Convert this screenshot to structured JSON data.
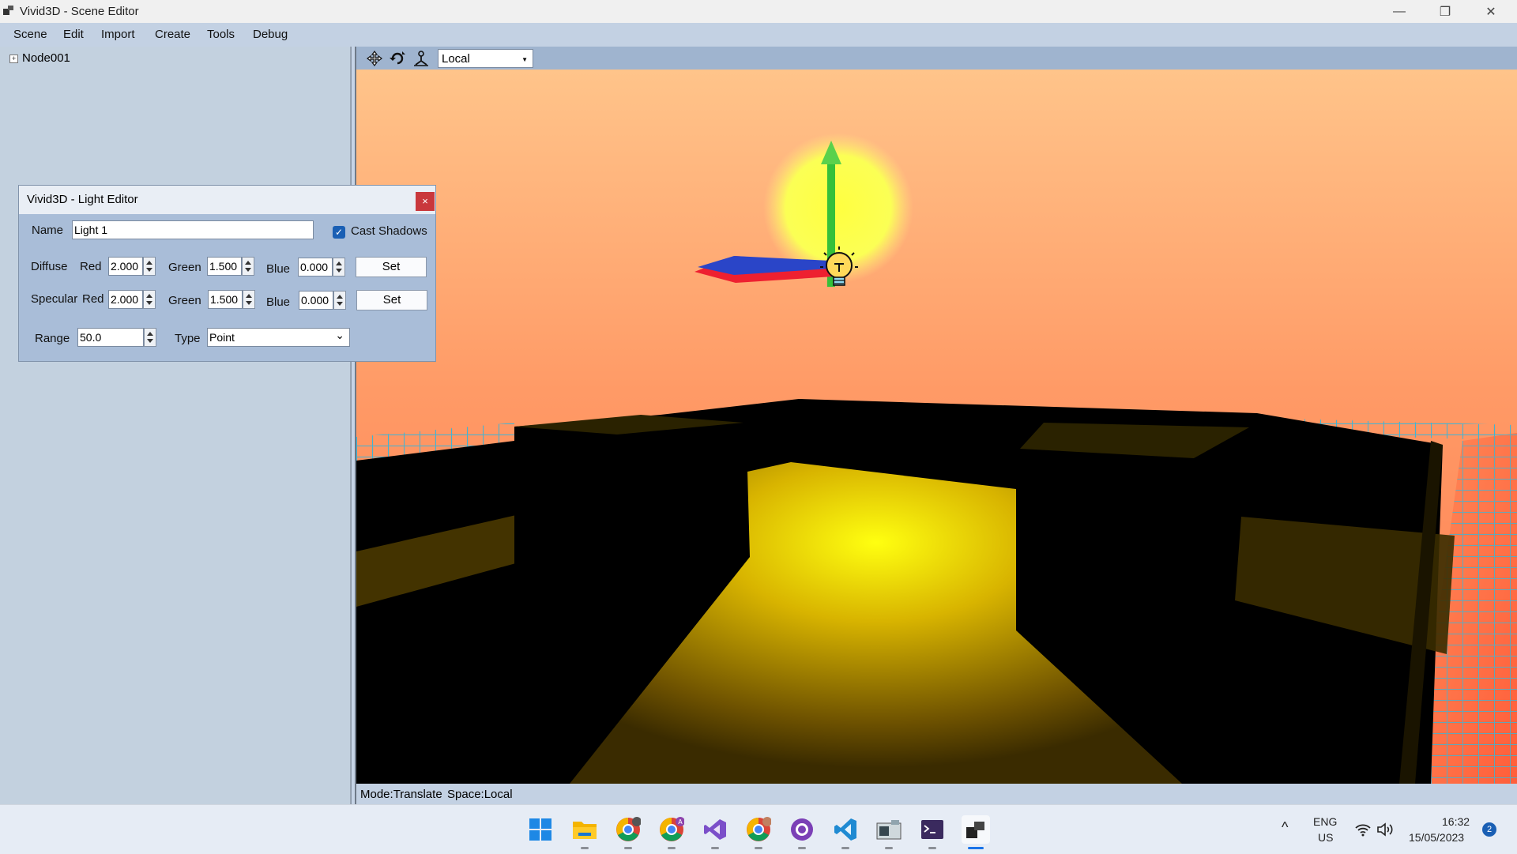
{
  "window": {
    "title": "Vivid3D - Scene Editor",
    "controls": {
      "minimize": "—",
      "restore": "❐",
      "close": "✕"
    }
  },
  "menu": [
    "Scene",
    "Edit",
    "Import",
    "Create",
    "Tools",
    "Debug"
  ],
  "scene_tree": {
    "expander": "+",
    "nodes": [
      {
        "label": "Node001"
      }
    ]
  },
  "viewport": {
    "toolbar": {
      "tools": [
        "move-icon",
        "rotate-icon",
        "scale-icon"
      ],
      "space_select": {
        "value": "Local",
        "arrow": "▼"
      }
    }
  },
  "status": {
    "mode": "Mode:Translate",
    "space": "Space:Local"
  },
  "light_editor": {
    "title": "Vivid3D - Light Editor",
    "close": "×",
    "name_label": "Name",
    "name_value": "Light 1",
    "cast_shadows_label": "Cast Shadows",
    "cast_shadows_checked": true,
    "check_mark": "✓",
    "diffuse": {
      "label": "Diffuse",
      "red_label": "Red",
      "red": "2.000",
      "green_label": "Green",
      "green": "1.500",
      "blue_label": "Blue",
      "blue": "0.000",
      "set_label": "Set"
    },
    "specular": {
      "label": "Specular",
      "red_label": "Red",
      "red": "2.000",
      "green_label": "Green",
      "green": "1.500",
      "blue_label": "Blue",
      "blue": "0.000",
      "set_label": "Set"
    },
    "range_label": "Range",
    "range_value": "50.0",
    "type_label": "Type",
    "type_value": "Point",
    "type_arrow": "⌄"
  },
  "taskbar": {
    "apps": [
      "windows-start-icon",
      "file-explorer-icon",
      "chrome-profile-1-icon",
      "chrome-profile-2-icon",
      "visual-studio-icon",
      "chrome-profile-3-icon",
      "github-desktop-icon",
      "vscode-icon",
      "media-app-icon",
      "terminal-icon",
      "vivid3d-icon"
    ],
    "profile_badge": "A",
    "tray_chevron": "^",
    "language": "ENG",
    "region": "US",
    "time": "16:32",
    "date": "15/05/2023",
    "notification_count": "2"
  },
  "colors": {
    "accent": "#1a5fb4",
    "menu_bar": "#c3d1e3",
    "panel": "#c3d1df",
    "dialog": "#a9bdd8",
    "close_red": "#c9383c"
  }
}
